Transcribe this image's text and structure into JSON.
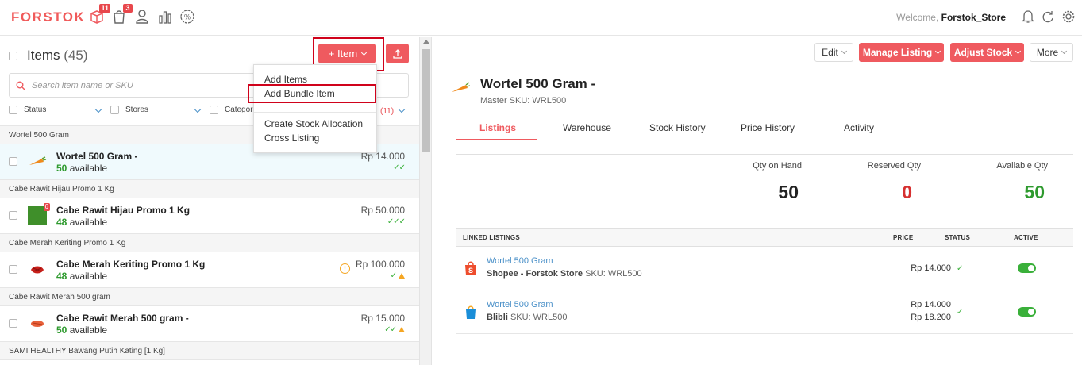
{
  "app": {
    "logo": "FORSTOK"
  },
  "topnav": {
    "badges": {
      "products": "11",
      "orders": "3"
    },
    "welcome_prefix": "Welcome, ",
    "welcome_user": "Forstok_Store"
  },
  "left": {
    "title": "Items",
    "count": "(45)",
    "add_item_label": "+ Item",
    "search_placeholder": "Search item name or SKU",
    "filters": {
      "status": "Status",
      "stores": "Stores",
      "category": "Categori",
      "count": "(11)"
    },
    "dropdown": [
      "Add Items",
      "Add Bundle Item",
      "Create Stock Allocation",
      "Cross Listing"
    ],
    "groups": [
      {
        "header": "Wortel 500 Gram",
        "name": "Wortel 500 Gram -",
        "qty": "50",
        "avail": " available",
        "price": "Rp 14.000",
        "marks": "✓✓"
      },
      {
        "header": "Cabe Rawit Hijau Promo 1 Kg",
        "name": "Cabe Rawit Hijau Promo 1 Kg",
        "qty": "48",
        "avail": " available",
        "price": "Rp 50.000",
        "marks": "✓✓✓",
        "img_badge": "6"
      },
      {
        "header": "Cabe Merah Keriting Promo 1 Kg",
        "name": "Cabe Merah Keriting Promo 1 Kg",
        "qty": "48",
        "avail": " available",
        "price": "Rp 100.000",
        "marks": "✓"
      },
      {
        "header": "Cabe Rawit Merah 500 gram",
        "name": "Cabe Rawit Merah 500 gram -",
        "qty": "50",
        "avail": " available",
        "price": "Rp 15.000",
        "marks": "✓✓"
      },
      {
        "header": "SAMI HEALTHY Bawang Putih Kating [1 Kg]"
      }
    ]
  },
  "right": {
    "buttons": {
      "edit": "Edit",
      "manage": "Manage Listing",
      "adjust": "Adjust Stock",
      "more": "More"
    },
    "title": "Wortel 500 Gram -",
    "sku": "Master SKU: WRL500",
    "tabs": [
      "Listings",
      "Warehouse",
      "Stock History",
      "Price History",
      "Activity"
    ],
    "stock": {
      "on_hand_label": "Qty on Hand",
      "on_hand": "50",
      "reserved_label": "Reserved Qty",
      "reserved": "0",
      "available_label": "Available Qty",
      "available": "50"
    },
    "linked": {
      "headers": {
        "title": "LINKED LISTINGS",
        "price": "PRICE",
        "status": "STATUS",
        "active": "ACTIVE"
      },
      "rows": [
        {
          "name": "Wortel 500 Gram",
          "store": "Shopee - Forstok Store",
          "sku": " SKU: WRL500",
          "price": "Rp  14.000",
          "status": "✓"
        },
        {
          "name": "Wortel 500 Gram",
          "store": "Blibli",
          "sku": " SKU: WRL500",
          "price": "Rp 14.000",
          "old_price": "Rp  18.200",
          "status": "✓"
        }
      ]
    }
  },
  "colors": {
    "brand": "#ef5a5f",
    "green": "#2e9a2e",
    "red": "#e8474c",
    "link": "#4a90c8"
  }
}
